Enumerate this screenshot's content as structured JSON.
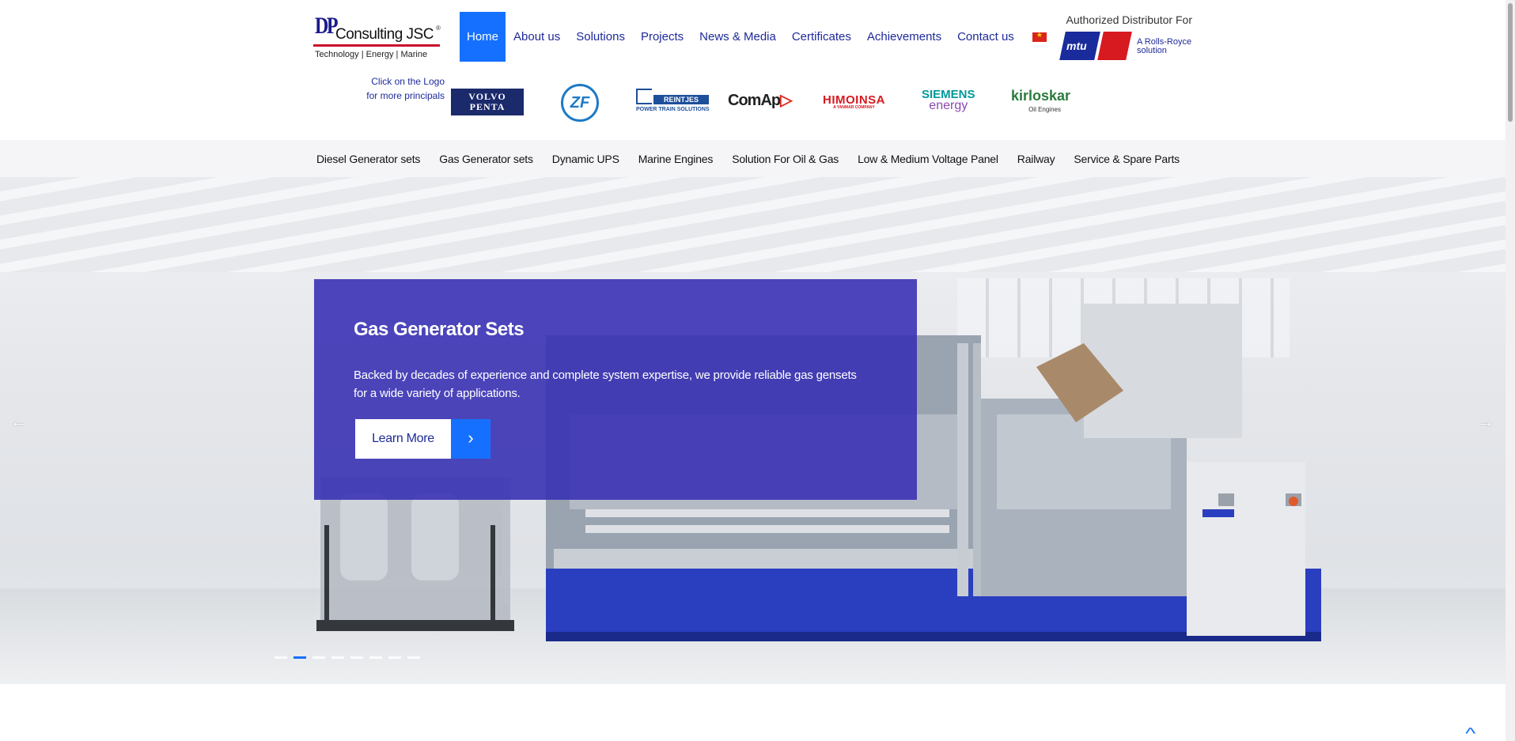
{
  "logo": {
    "mark": "DP",
    "name": "Consulting JSC",
    "registered": "®",
    "tagline": "Technology | Energy | Marine"
  },
  "main_nav": [
    {
      "label": "Home",
      "active": true
    },
    {
      "label": "About us"
    },
    {
      "label": "Solutions"
    },
    {
      "label": "Projects"
    },
    {
      "label": "News & Media"
    },
    {
      "label": "Certificates"
    },
    {
      "label": "Achievements"
    },
    {
      "label": "Contact us"
    }
  ],
  "language_flag": "vn-flag-icon",
  "distributor": {
    "label": "Authorized Distributor For",
    "brand": "mtu",
    "note_line1": "A Rolls-Royce",
    "note_line2": "solution"
  },
  "brands": {
    "hint_line1": "Click on the Logo",
    "hint_line2": "for more principals",
    "volvo_line1": "VOLVO",
    "volvo_line2": "PENTA",
    "zf": "ZF",
    "reintjes": "REINTJES",
    "reintjes_sub": "POWER TRAIN SOLUTIONS",
    "comap": "ComAp",
    "himoinsa": "HIMOINSA",
    "himoinsa_sub": "A YANMAR COMPANY",
    "siemens_line1": "SIEMENS",
    "siemens_line2": "energy",
    "kirloskar": "kirloskar",
    "kirloskar_sub": "Oil Engines"
  },
  "sub_nav": [
    "Diesel Generator sets",
    "Gas Generator sets",
    "Dynamic UPS",
    "Marine Engines",
    "Solution For Oil & Gas",
    "Low & Medium Voltage Panel",
    "Railway",
    "Service & Spare Parts"
  ],
  "hero": {
    "title": "Gas Generator Sets",
    "description": "Backed by decades of experience and complete system expertise, we provide reliable gas gensets for a wide variety of applications.",
    "button_label": "Learn More",
    "slide_count": 8,
    "active_slide": 2
  },
  "colors": {
    "accent": "#1670ff",
    "nav_text": "#1e2a9a",
    "overlay": "#3a32b4",
    "engine_blue": "#2a3ec0"
  }
}
